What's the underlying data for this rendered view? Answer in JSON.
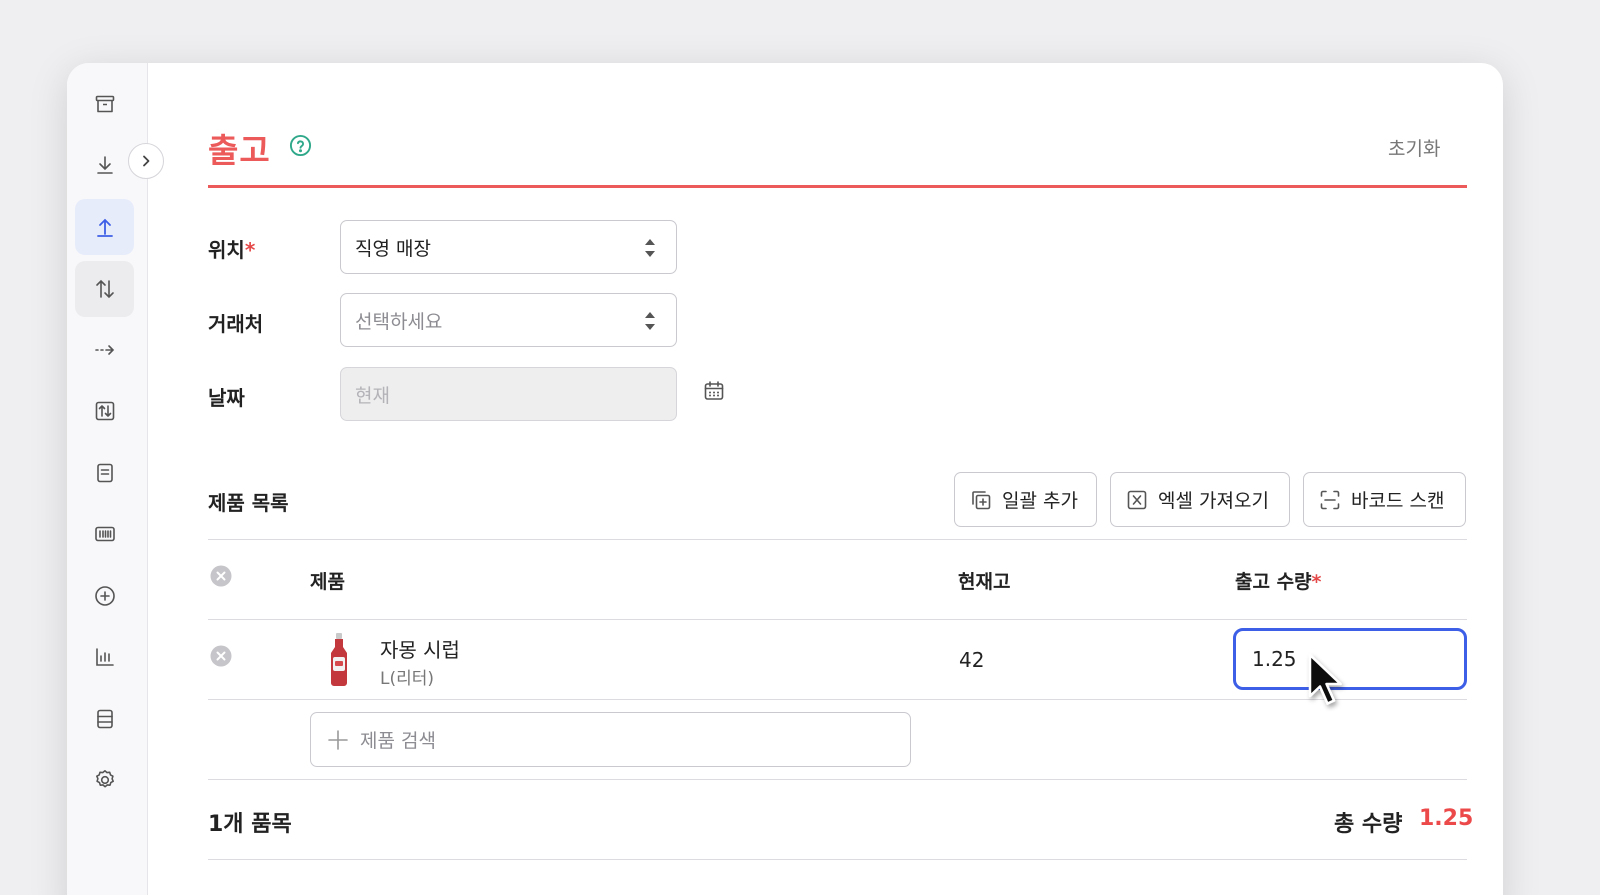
{
  "sidebar": {
    "items": [
      {
        "icon": "box-icon",
        "state": "default"
      },
      {
        "icon": "download-icon",
        "state": "default"
      },
      {
        "icon": "upload-icon",
        "state": "active"
      },
      {
        "icon": "transfer-icon",
        "state": "hover"
      },
      {
        "icon": "move-arrow-icon",
        "state": "default"
      },
      {
        "icon": "adjust-icon",
        "state": "default"
      },
      {
        "icon": "document-icon",
        "state": "default"
      },
      {
        "icon": "barcode-icon",
        "state": "default"
      },
      {
        "icon": "plus-circle-icon",
        "state": "default"
      },
      {
        "icon": "bar-chart-icon",
        "state": "default"
      },
      {
        "icon": "database-icon",
        "state": "default"
      },
      {
        "icon": "settings-icon",
        "state": "default"
      }
    ]
  },
  "header": {
    "title": "출고",
    "reset_label": "초기화"
  },
  "form": {
    "location": {
      "label": "위치",
      "required": "*",
      "value": "직영 매장"
    },
    "partner": {
      "label": "거래처",
      "placeholder": "선택하세요"
    },
    "date": {
      "label": "날짜",
      "placeholder": "현재"
    }
  },
  "products": {
    "section_label": "제품 목록",
    "buttons": {
      "bulk_add": "일괄 추가",
      "excel_import": "엑셀 가져오기",
      "barcode_scan": "바코드 스캔"
    },
    "columns": {
      "product": "제품",
      "stock": "현재고",
      "quantity": "출고 수량",
      "required": "*"
    },
    "rows": [
      {
        "name": "자몽 시럽",
        "unit": "L(리터)",
        "stock": "42",
        "quantity": "1.25"
      }
    ],
    "search_placeholder": "제품 검색"
  },
  "summary": {
    "item_count": "1개 품목",
    "total_label": "총 수량",
    "total_value": "1.25"
  },
  "colors": {
    "accent": "#ec5a5a",
    "focus": "#3d5ee6",
    "active_nav": "#e7ecfb"
  }
}
